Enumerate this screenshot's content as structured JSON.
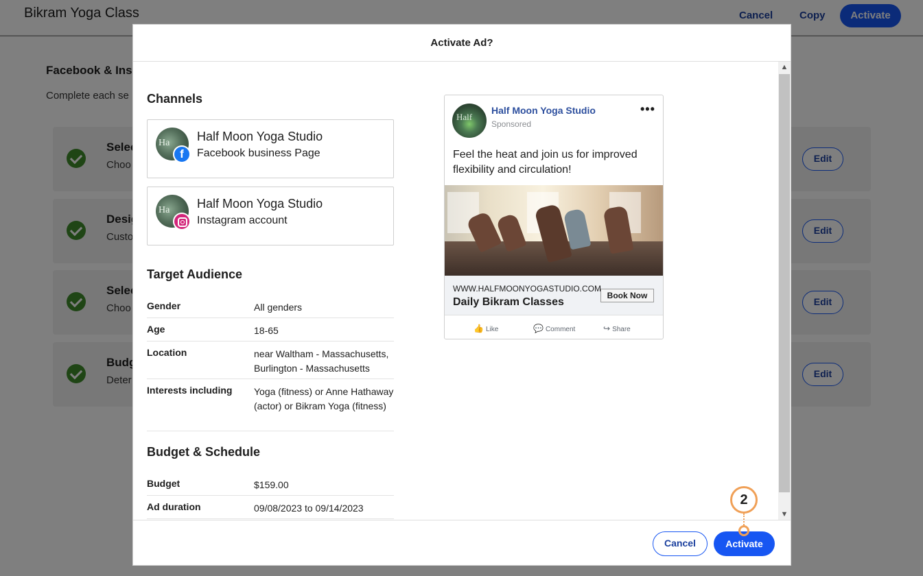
{
  "page": {
    "title": "Bikram Yoga Class",
    "header_actions": {
      "cancel": "Cancel",
      "copy": "Copy",
      "activate": "Activate"
    },
    "section_title": "Facebook & Ins",
    "section_subtitle": "Complete each se",
    "steps": [
      {
        "title": "Selec",
        "desc": "Choo",
        "edit": "Edit"
      },
      {
        "title": "Desig",
        "desc": "Custo",
        "edit": "Edit"
      },
      {
        "title": "Selec",
        "desc": "Choo",
        "edit": "Edit"
      },
      {
        "title": "Budg",
        "desc": "Deter",
        "edit": "Edit"
      }
    ]
  },
  "modal": {
    "title": "Activate Ad?",
    "channels_heading": "Channels",
    "channels": [
      {
        "name": "Half Moon Yoga Studio",
        "type": "Facebook business Page",
        "badge_icon": "facebook-icon",
        "avatar_text": "Ha",
        "badge_glyph": "f"
      },
      {
        "name": "Half Moon Yoga Studio",
        "type": "Instagram account",
        "badge_icon": "instagram-icon",
        "avatar_text": "Ha"
      }
    ],
    "audience_heading": "Target Audience",
    "audience": [
      {
        "label": "Gender",
        "value": "All genders"
      },
      {
        "label": "Age",
        "value": "18-65"
      },
      {
        "label": "Location",
        "value": "near Waltham - Massachusetts, Burlington - Massachusetts"
      },
      {
        "label": "Interests including",
        "value": "Yoga (fitness) or Anne Hathaway (actor) or Bikram Yoga (fitness)"
      }
    ],
    "budget_heading": "Budget & Schedule",
    "budget": [
      {
        "label": "Budget",
        "value": "$159.00"
      },
      {
        "label": "Ad duration",
        "value": "09/08/2023 to 09/14/2023"
      }
    ],
    "ad_preview": {
      "page_name": "Half Moon Yoga Studio",
      "sponsored": "Sponsored",
      "more": "•••",
      "avatar_text": "Half",
      "text": "Feel the heat and join us for improved flexibility and circulation!",
      "url": "WWW.HALFMOONYOGASTUDIO.COM",
      "headline": "Daily Bikram Classes",
      "cta": "Book Now",
      "actions": [
        {
          "label": "Like",
          "icon": "like-icon",
          "glyph": "👍"
        },
        {
          "label": "Comment",
          "icon": "comment-icon",
          "glyph": "💬"
        },
        {
          "label": "Share",
          "icon": "share-icon",
          "glyph": "↪"
        }
      ]
    },
    "footer": {
      "cancel": "Cancel",
      "activate": "Activate"
    }
  },
  "callout": {
    "number": "2"
  },
  "colors": {
    "primary": "#1756f2",
    "link": "#1a3f9e",
    "success": "#3f8a2a",
    "callout": "#f0a057",
    "facebook": "#1877f2",
    "instagram": "#d3257a"
  }
}
